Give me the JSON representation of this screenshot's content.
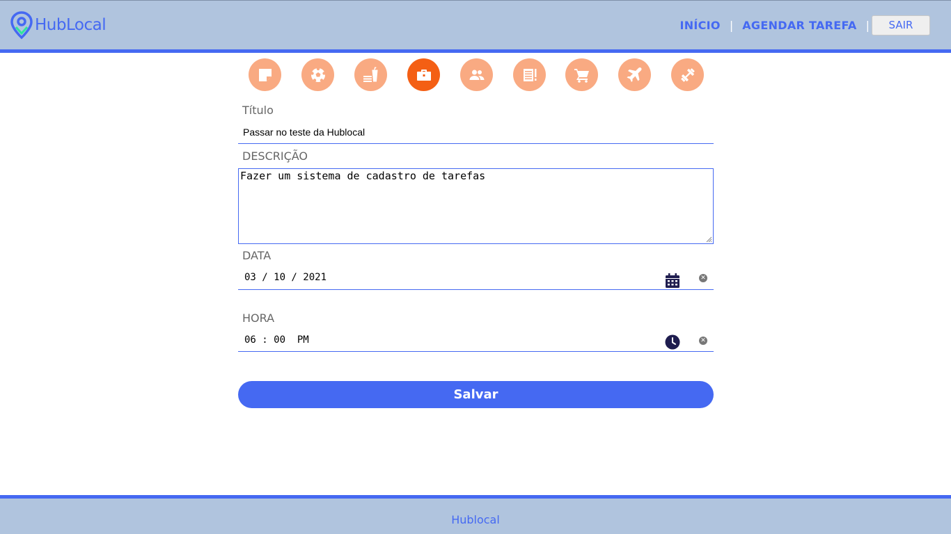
{
  "header": {
    "logo_text": "HubLocal",
    "nav": {
      "home_label": "INÍCIO",
      "schedule_label": "AGENDAR TAREFA",
      "logout_label": "SAIR"
    }
  },
  "categories": [
    {
      "icon": "sticky-note-icon",
      "active": false
    },
    {
      "icon": "soccer-ball-icon",
      "active": false
    },
    {
      "icon": "fastfood-icon",
      "active": false
    },
    {
      "icon": "briefcase-icon",
      "active": true
    },
    {
      "icon": "people-icon",
      "active": false
    },
    {
      "icon": "newspaper-icon",
      "active": false
    },
    {
      "icon": "shopping-cart-icon",
      "active": false
    },
    {
      "icon": "airplane-icon",
      "active": false
    },
    {
      "icon": "dumbbell-icon",
      "active": false
    }
  ],
  "form": {
    "title_label": "Título",
    "title_value": "Passar no teste da Hublocal",
    "description_label": "DESCRIÇÃO",
    "description_value": "Fazer um sistema de cadastro de tarefas",
    "date_label": "DATA",
    "date_value": "03 / 10 / 2021",
    "time_label": "HORA",
    "time_value": "06 : 00  PM",
    "save_label": "Salvar"
  },
  "footer": {
    "text": "Hublocal"
  },
  "colors": {
    "primary": "#4569f2",
    "header_bg": "#b0c4de",
    "category_inactive": "#f9aa82",
    "category_active": "#f45f14",
    "picker_icon": "#1f1d4f"
  }
}
